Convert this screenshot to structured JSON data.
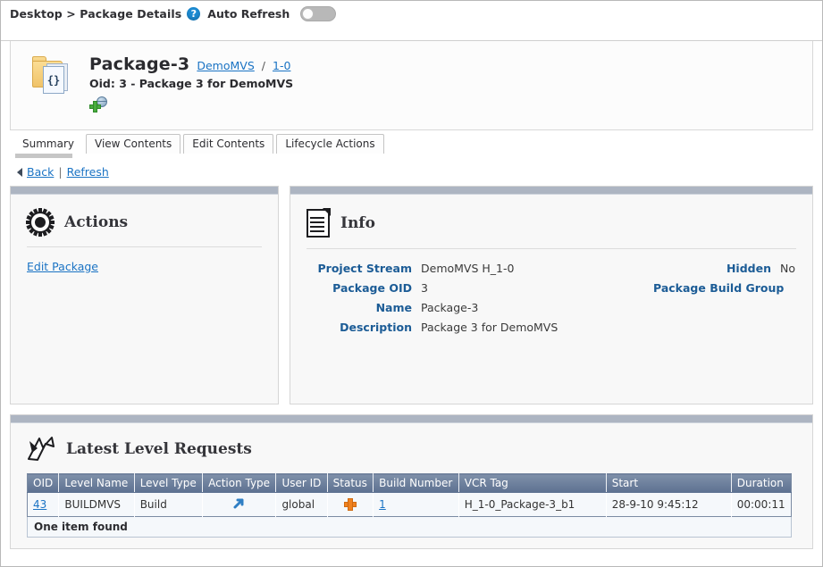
{
  "breadcrumb": {
    "text": "Desktop > Package Details",
    "help_icon": "help-circle-icon",
    "auto_refresh_label": "Auto Refresh",
    "auto_refresh_state": "off"
  },
  "package_header": {
    "icon": "package-folder-icon",
    "sheet_glyph": "{}",
    "title": "Package-3",
    "stream_link": "DemoMVS",
    "separator": "/",
    "version_link": "1-0",
    "subtitle": "Oid: 3 - Package 3 for DemoMVS",
    "add_globe_icon": "add-global-icon"
  },
  "tabs": [
    {
      "label": "Summary",
      "active": true
    },
    {
      "label": "View Contents",
      "active": false
    },
    {
      "label": "Edit Contents",
      "active": false
    },
    {
      "label": "Lifecycle Actions",
      "active": false
    }
  ],
  "nav": {
    "back_icon": "back-arrow-icon",
    "back_label": "Back",
    "separator": "|",
    "refresh_label": "Refresh"
  },
  "actions_panel": {
    "icon": "gear-icon",
    "title": "Actions",
    "links": [
      {
        "label": "Edit Package"
      }
    ]
  },
  "info_panel": {
    "icon": "document-icon",
    "title": "Info",
    "rows": [
      {
        "label": "Project Stream",
        "value": "DemoMVS H_1-0",
        "label2": "Hidden",
        "value2": "No"
      },
      {
        "label": "Package OID",
        "value": "3",
        "label2": "Package Build Group",
        "value2": ""
      },
      {
        "label": "Name",
        "value": "Package-3",
        "label2": "",
        "value2": ""
      },
      {
        "label": "Description",
        "value": "Package 3 for DemoMVS",
        "label2": "",
        "value2": ""
      }
    ]
  },
  "requests_panel": {
    "icon": "level-requests-icon",
    "title": "Latest Level Requests",
    "columns": [
      "OID",
      "Level Name",
      "Level Type",
      "Action Type",
      "User ID",
      "Status",
      "Build Number",
      "VCR Tag",
      "Start",
      "Duration"
    ],
    "rows": [
      {
        "oid": "43",
        "level_name": "BUILDMVS",
        "level_type": "Build",
        "action_type_icon": "arrow-up-right-icon",
        "user_id": "global",
        "status_icon": "orange-plus-icon",
        "build_number": "1",
        "vcr_tag": "H_1-0_Package-3_b1",
        "start": "28-9-10 9:45:12",
        "duration": "00:00:11"
      }
    ],
    "footer": "One item found"
  },
  "colors": {
    "link": "#1a73c4",
    "label": "#1c5c96",
    "panel_bar": "#adb5c2",
    "table_header_top": "#7f90a9",
    "table_header_bottom": "#5d7191",
    "status_orange": "#f0821e",
    "help_blue": "#1c8ad1"
  }
}
